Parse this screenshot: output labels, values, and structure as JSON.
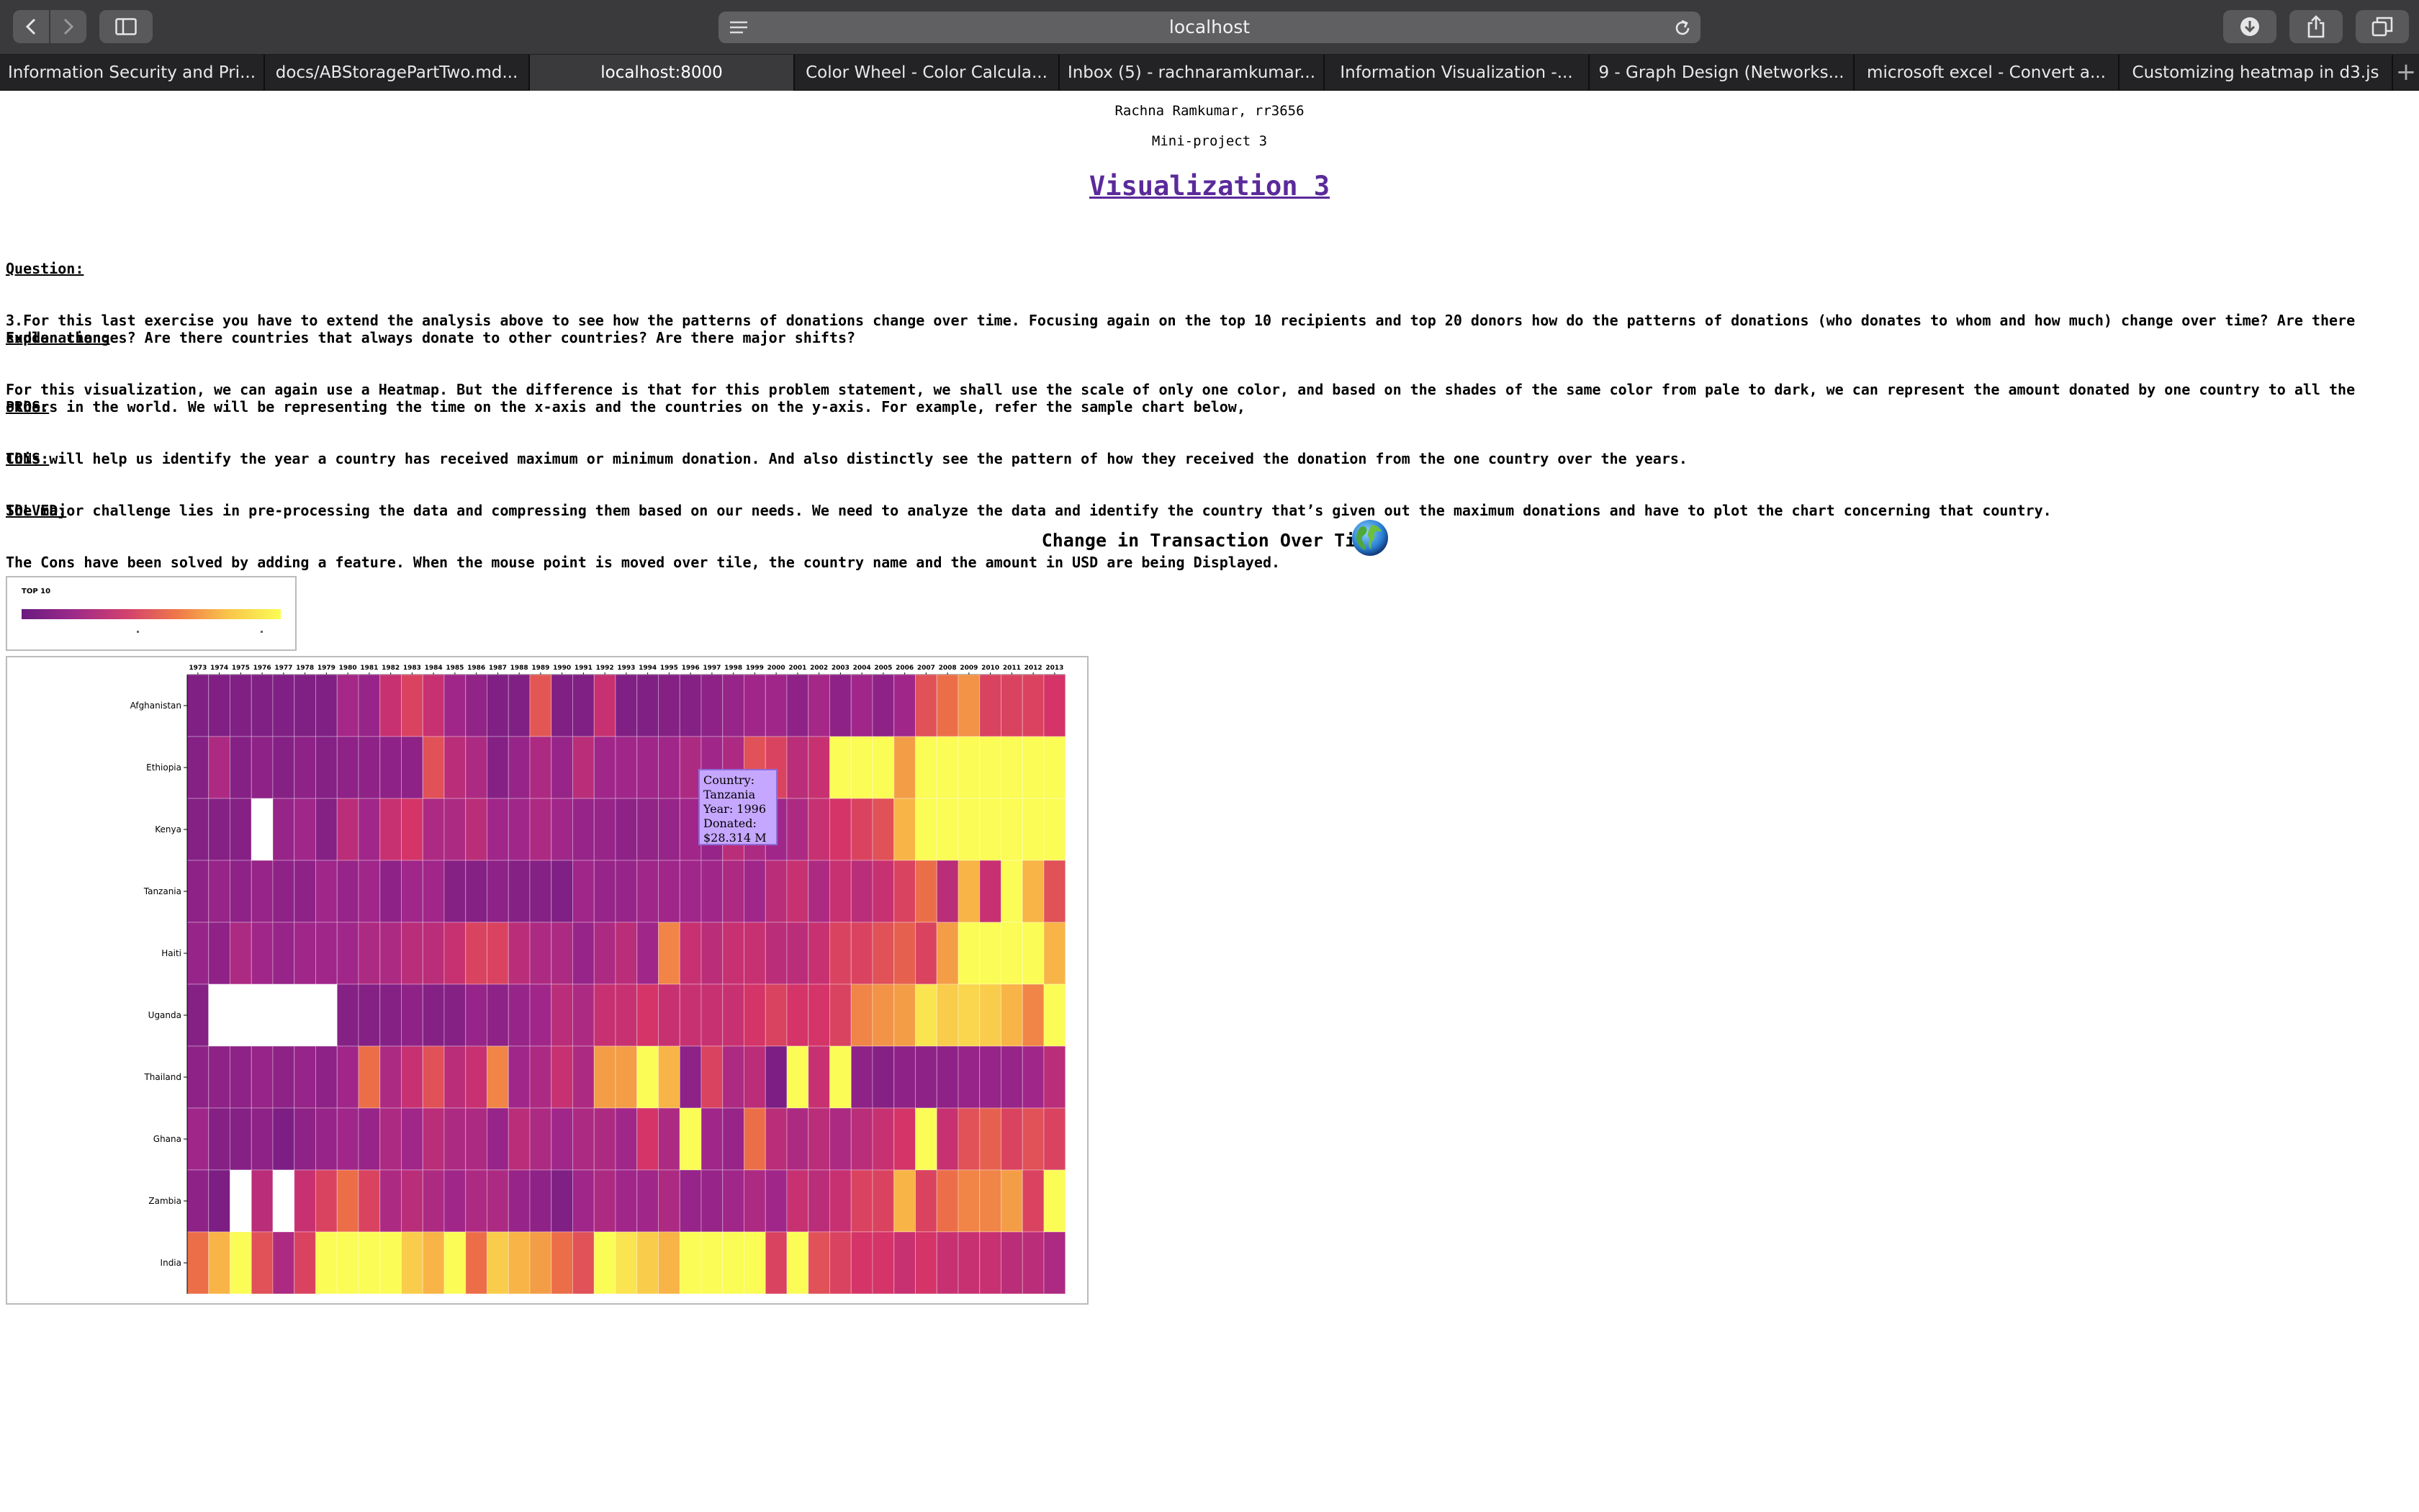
{
  "browser": {
    "url": "localhost",
    "tabs": [
      {
        "label": "Information Security and Pri...",
        "active": false
      },
      {
        "label": "docs/ABStoragePartTwo.md...",
        "active": false
      },
      {
        "label": "localhost:8000",
        "active": true
      },
      {
        "label": "Color Wheel - Color Calcula...",
        "active": false
      },
      {
        "label": "Inbox (5) - rachnaramkumar...",
        "active": false
      },
      {
        "label": "Information Visualization -...",
        "active": false
      },
      {
        "label": "9 - Graph Design (Networks...",
        "active": false
      },
      {
        "label": "microsoft excel - Convert a...",
        "active": false
      },
      {
        "label": "Customizing heatmap in d3.js",
        "active": false
      }
    ],
    "icons": [
      "back-icon",
      "forward-icon",
      "sidebar-icon",
      "reader-icon",
      "reload-icon",
      "download-icon",
      "share-icon",
      "tabs-overview-icon",
      "new-tab-icon"
    ]
  },
  "page": {
    "author": "Rachna Ramkumar, rr3656",
    "project": "Mini-project 3",
    "title": "Visualization 3",
    "question_label": "Question:",
    "question_text": "3.For this last exercise you have to extend the analysis above to see how the patterns of donations change over time. Focusing again on the top 10 recipients and top 20 donors how do the patterns of donations (who donates to whom and how much) change over time? Are there sudden changes? Are there countries that always donate to other countries? Are there major shifts?",
    "explanation_label": "Explanation:",
    "explanation_text": "For this visualization, we can again use a Heatmap. But the difference is that for this problem statement, we shall use the scale of only one color, and based on the shades of the same color from pale to dark, we can represent the amount donated by one country to all the others in the world. We will be representing the time on the x-axis and the countries on the y-axis. For example, refer the sample chart below,",
    "pros_label": "PROS:",
    "pros_text": "This will help us identify the year a country has received maximum or minimum donation. And also distinctly see the pattern of how they received the donation from the one country over the years.",
    "cons_label": "CONS:",
    "cons_text": "The major challenge lies in pre-processing the data and compressing them based on our needs. We need to analyze the data and identify the country that’s given out the maximum donations and have to plot the chart concerning that country.",
    "solved_label": "SOLVED:",
    "solved_text": "The Cons have been solved by adding a feature. When the mouse point is moved over tile, the country name and the amount in USD are being Displayed.",
    "chart_title": "Change in Transaction Over Time",
    "legend_title": "TOP 10",
    "tooltip": {
      "line1": "Country:",
      "line2": "Tanzania",
      "line3": "Year: 1996",
      "line4": "Donated:",
      "line5": "$28.314 M"
    }
  },
  "colors": {
    "purple": "#6a1a80",
    "magenta": "#b72a7c",
    "red": "#d9365f",
    "orange": "#f07a4a",
    "yellow": "#fbfc55",
    "missing": "#ffffff",
    "tooltip_bg": "#c6a7ff",
    "title_link": "#5a2a9a"
  },
  "chart_data": {
    "type": "heatmap",
    "x": [
      "1973",
      "1974",
      "1975",
      "1976",
      "1977",
      "1978",
      "1979",
      "1980",
      "1981",
      "1982",
      "1983",
      "1984",
      "1985",
      "1986",
      "1987",
      "1988",
      "1989",
      "1990",
      "1991",
      "1992",
      "1993",
      "1994",
      "1995",
      "1996",
      "1997",
      "1998",
      "1999",
      "2000",
      "2001",
      "2002",
      "2003",
      "2004",
      "2005",
      "2006",
      "2007",
      "2008",
      "2009",
      "2010",
      "2011",
      "2012",
      "2013"
    ],
    "y": [
      "Afghanistan",
      "Ethiopia",
      "Kenya",
      "Tanzania",
      "Haiti",
      "Uganda",
      "Thailand",
      "Ghana",
      "Zambia",
      "India"
    ],
    "value_scale": "0 = dark purple (low donation) to 1 = yellow (high donation); null = no data",
    "values": [
      [
        0.12,
        0.12,
        0.12,
        0.12,
        0.12,
        0.12,
        0.12,
        0.32,
        0.25,
        0.45,
        0.55,
        0.45,
        0.3,
        0.22,
        0.12,
        0.12,
        0.62,
        0.12,
        0.12,
        0.45,
        0.12,
        0.12,
        0.15,
        0.15,
        0.2,
        0.25,
        0.3,
        0.3,
        0.2,
        0.32,
        0.2,
        0.3,
        0.2,
        0.3,
        0.6,
        0.7,
        0.78,
        0.55,
        0.55,
        0.55,
        0.5
      ],
      [
        0.15,
        0.35,
        0.15,
        0.2,
        0.15,
        0.2,
        0.15,
        0.2,
        0.2,
        0.2,
        0.2,
        0.6,
        0.4,
        0.35,
        0.15,
        0.25,
        0.35,
        0.25,
        0.4,
        0.3,
        0.3,
        0.3,
        0.3,
        0.35,
        0.3,
        0.35,
        0.6,
        0.55,
        0.4,
        0.45,
        1.0,
        1.0,
        1.0,
        0.8,
        1.0,
        1.0,
        1.0,
        1.0,
        1.0,
        1.0,
        1.0
      ],
      [
        0.15,
        0.15,
        0.15,
        null,
        0.25,
        0.3,
        0.15,
        0.4,
        0.3,
        0.45,
        0.5,
        0.35,
        0.35,
        0.4,
        0.3,
        0.3,
        0.35,
        0.3,
        0.25,
        0.25,
        0.2,
        0.22,
        0.25,
        0.3,
        0.25,
        0.4,
        0.35,
        0.3,
        0.35,
        0.45,
        0.5,
        0.55,
        0.6,
        0.85,
        1.0,
        1.0,
        1.0,
        1.0,
        1.0,
        1.0,
        1.0
      ],
      [
        0.2,
        0.25,
        0.2,
        0.25,
        0.2,
        0.2,
        0.3,
        0.25,
        0.3,
        0.2,
        0.3,
        0.3,
        0.15,
        0.15,
        0.2,
        0.15,
        0.15,
        0.12,
        0.3,
        0.25,
        0.25,
        0.3,
        0.3,
        0.3,
        0.3,
        0.35,
        0.3,
        0.4,
        0.45,
        0.35,
        0.45,
        0.4,
        0.45,
        0.55,
        0.7,
        0.4,
        0.85,
        0.45,
        1.0,
        0.85,
        0.6
      ],
      [
        0.25,
        0.2,
        0.35,
        0.3,
        0.25,
        0.3,
        0.3,
        0.3,
        0.35,
        0.35,
        0.4,
        0.4,
        0.45,
        0.55,
        0.55,
        0.4,
        0.35,
        0.35,
        0.25,
        0.35,
        0.4,
        0.3,
        0.75,
        0.45,
        0.4,
        0.45,
        0.45,
        0.4,
        0.4,
        0.45,
        0.55,
        0.55,
        0.6,
        0.65,
        0.55,
        0.8,
        1.0,
        1.0,
        1.0,
        1.0,
        0.85
      ],
      [
        0.15,
        null,
        null,
        null,
        null,
        null,
        null,
        0.15,
        0.15,
        0.15,
        0.2,
        0.15,
        0.15,
        0.25,
        0.2,
        0.25,
        0.3,
        0.4,
        0.35,
        0.45,
        0.45,
        0.5,
        0.45,
        0.45,
        0.45,
        0.45,
        0.5,
        0.55,
        0.5,
        0.5,
        0.55,
        0.75,
        0.78,
        0.8,
        0.95,
        0.9,
        0.92,
        0.9,
        0.85,
        0.75,
        1.0
      ],
      [
        0.2,
        0.2,
        0.2,
        0.25,
        0.2,
        0.25,
        0.2,
        0.3,
        0.7,
        0.35,
        0.45,
        0.6,
        0.4,
        0.45,
        0.75,
        0.3,
        0.35,
        0.45,
        0.35,
        0.8,
        0.8,
        1.0,
        0.85,
        0.2,
        0.55,
        0.35,
        0.4,
        0.1,
        1.0,
        0.45,
        1.0,
        0.2,
        0.15,
        0.2,
        0.2,
        0.2,
        0.25,
        0.25,
        0.25,
        0.3,
        0.4
      ],
      [
        0.3,
        0.15,
        0.15,
        0.2,
        0.1,
        0.2,
        0.25,
        0.3,
        0.25,
        0.35,
        0.3,
        0.4,
        0.35,
        0.35,
        0.25,
        0.4,
        0.35,
        0.3,
        0.35,
        0.35,
        0.3,
        0.5,
        0.35,
        1.0,
        0.3,
        0.25,
        0.7,
        0.4,
        0.35,
        0.4,
        0.35,
        0.4,
        0.45,
        0.5,
        1.0,
        0.45,
        0.6,
        0.65,
        0.55,
        0.6,
        0.55
      ],
      [
        0.2,
        0.1,
        null,
        0.4,
        null,
        0.45,
        0.55,
        0.7,
        0.55,
        0.35,
        0.4,
        0.35,
        0.3,
        0.35,
        0.35,
        0.25,
        0.2,
        0.12,
        0.3,
        0.35,
        0.3,
        0.3,
        0.35,
        0.25,
        0.25,
        0.3,
        0.35,
        0.3,
        0.45,
        0.4,
        0.45,
        0.55,
        0.55,
        0.85,
        0.55,
        0.7,
        0.75,
        0.75,
        0.8,
        0.55,
        1.0
      ],
      [
        0.7,
        0.85,
        1.0,
        0.6,
        0.35,
        0.55,
        1.0,
        1.0,
        1.0,
        1.0,
        0.9,
        0.85,
        1.0,
        0.7,
        0.9,
        0.85,
        0.8,
        0.7,
        0.6,
        1.0,
        0.95,
        0.9,
        0.85,
        1.0,
        1.0,
        1.0,
        1.0,
        0.55,
        1.0,
        0.6,
        0.55,
        0.5,
        0.5,
        0.45,
        0.5,
        0.45,
        0.45,
        0.45,
        0.4,
        0.4,
        0.35
      ]
    ],
    "highlight": {
      "country": "Tanzania",
      "year": "1996",
      "donated": "$28.314 M"
    }
  }
}
